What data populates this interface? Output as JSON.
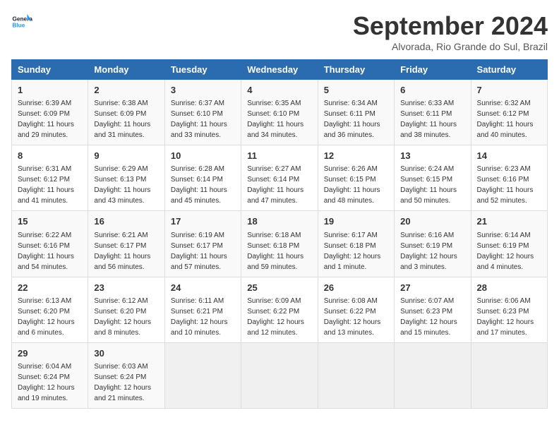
{
  "header": {
    "logo_line1": "General",
    "logo_line2": "Blue",
    "month": "September 2024",
    "location": "Alvorada, Rio Grande do Sul, Brazil"
  },
  "days_of_week": [
    "Sunday",
    "Monday",
    "Tuesday",
    "Wednesday",
    "Thursday",
    "Friday",
    "Saturday"
  ],
  "weeks": [
    [
      {
        "day": "1",
        "sunrise": "6:39 AM",
        "sunset": "6:09 PM",
        "daylight": "11 hours and 29 minutes."
      },
      {
        "day": "2",
        "sunrise": "6:38 AM",
        "sunset": "6:09 PM",
        "daylight": "11 hours and 31 minutes."
      },
      {
        "day": "3",
        "sunrise": "6:37 AM",
        "sunset": "6:10 PM",
        "daylight": "11 hours and 33 minutes."
      },
      {
        "day": "4",
        "sunrise": "6:35 AM",
        "sunset": "6:10 PM",
        "daylight": "11 hours and 34 minutes."
      },
      {
        "day": "5",
        "sunrise": "6:34 AM",
        "sunset": "6:11 PM",
        "daylight": "11 hours and 36 minutes."
      },
      {
        "day": "6",
        "sunrise": "6:33 AM",
        "sunset": "6:11 PM",
        "daylight": "11 hours and 38 minutes."
      },
      {
        "day": "7",
        "sunrise": "6:32 AM",
        "sunset": "6:12 PM",
        "daylight": "11 hours and 40 minutes."
      }
    ],
    [
      {
        "day": "8",
        "sunrise": "6:31 AM",
        "sunset": "6:12 PM",
        "daylight": "11 hours and 41 minutes."
      },
      {
        "day": "9",
        "sunrise": "6:29 AM",
        "sunset": "6:13 PM",
        "daylight": "11 hours and 43 minutes."
      },
      {
        "day": "10",
        "sunrise": "6:28 AM",
        "sunset": "6:14 PM",
        "daylight": "11 hours and 45 minutes."
      },
      {
        "day": "11",
        "sunrise": "6:27 AM",
        "sunset": "6:14 PM",
        "daylight": "11 hours and 47 minutes."
      },
      {
        "day": "12",
        "sunrise": "6:26 AM",
        "sunset": "6:15 PM",
        "daylight": "11 hours and 48 minutes."
      },
      {
        "day": "13",
        "sunrise": "6:24 AM",
        "sunset": "6:15 PM",
        "daylight": "11 hours and 50 minutes."
      },
      {
        "day": "14",
        "sunrise": "6:23 AM",
        "sunset": "6:16 PM",
        "daylight": "11 hours and 52 minutes."
      }
    ],
    [
      {
        "day": "15",
        "sunrise": "6:22 AM",
        "sunset": "6:16 PM",
        "daylight": "11 hours and 54 minutes."
      },
      {
        "day": "16",
        "sunrise": "6:21 AM",
        "sunset": "6:17 PM",
        "daylight": "11 hours and 56 minutes."
      },
      {
        "day": "17",
        "sunrise": "6:19 AM",
        "sunset": "6:17 PM",
        "daylight": "11 hours and 57 minutes."
      },
      {
        "day": "18",
        "sunrise": "6:18 AM",
        "sunset": "6:18 PM",
        "daylight": "11 hours and 59 minutes."
      },
      {
        "day": "19",
        "sunrise": "6:17 AM",
        "sunset": "6:18 PM",
        "daylight": "12 hours and 1 minute."
      },
      {
        "day": "20",
        "sunrise": "6:16 AM",
        "sunset": "6:19 PM",
        "daylight": "12 hours and 3 minutes."
      },
      {
        "day": "21",
        "sunrise": "6:14 AM",
        "sunset": "6:19 PM",
        "daylight": "12 hours and 4 minutes."
      }
    ],
    [
      {
        "day": "22",
        "sunrise": "6:13 AM",
        "sunset": "6:20 PM",
        "daylight": "12 hours and 6 minutes."
      },
      {
        "day": "23",
        "sunrise": "6:12 AM",
        "sunset": "6:20 PM",
        "daylight": "12 hours and 8 minutes."
      },
      {
        "day": "24",
        "sunrise": "6:11 AM",
        "sunset": "6:21 PM",
        "daylight": "12 hours and 10 minutes."
      },
      {
        "day": "25",
        "sunrise": "6:09 AM",
        "sunset": "6:22 PM",
        "daylight": "12 hours and 12 minutes."
      },
      {
        "day": "26",
        "sunrise": "6:08 AM",
        "sunset": "6:22 PM",
        "daylight": "12 hours and 13 minutes."
      },
      {
        "day": "27",
        "sunrise": "6:07 AM",
        "sunset": "6:23 PM",
        "daylight": "12 hours and 15 minutes."
      },
      {
        "day": "28",
        "sunrise": "6:06 AM",
        "sunset": "6:23 PM",
        "daylight": "12 hours and 17 minutes."
      }
    ],
    [
      {
        "day": "29",
        "sunrise": "6:04 AM",
        "sunset": "6:24 PM",
        "daylight": "12 hours and 19 minutes."
      },
      {
        "day": "30",
        "sunrise": "6:03 AM",
        "sunset": "6:24 PM",
        "daylight": "12 hours and 21 minutes."
      },
      null,
      null,
      null,
      null,
      null
    ]
  ],
  "labels": {
    "sunrise": "Sunrise:",
    "sunset": "Sunset:",
    "daylight": "Daylight:"
  }
}
